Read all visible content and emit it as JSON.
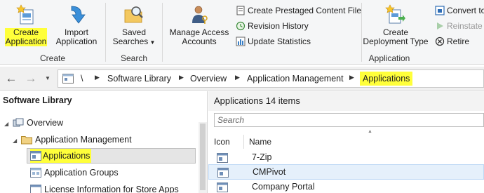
{
  "ribbon": {
    "create_application": "Create\nApplication",
    "create_line1": "Create",
    "create_line2": "Application",
    "import_line1": "Import",
    "import_line2": "Application",
    "group_create": "Create",
    "saved_line1": "Saved",
    "saved_line2": "Searches",
    "group_search": "Search",
    "manage_line1": "Manage Access",
    "manage_line2": "Accounts",
    "create_prestaged": "Create Prestaged Content File",
    "revision_history": "Revision History",
    "update_statistics": "Update Statistics",
    "deploy_line1": "Create",
    "deploy_line2": "Deployment Type",
    "group_application": "Application",
    "convert_to": "Convert to",
    "reinstate": "Reinstate",
    "retire": "Retire"
  },
  "breadcrumb": {
    "root": "\\",
    "items": [
      "Software Library",
      "Overview",
      "Application Management",
      "Applications"
    ]
  },
  "left_pane": {
    "title": "Software Library",
    "tree": {
      "overview": "Overview",
      "app_mgmt": "Application Management",
      "applications": "Applications",
      "app_groups": "Application Groups",
      "license_info": "License Information for Store Apps"
    }
  },
  "right_pane": {
    "header_title": "Applications",
    "header_count": "14 items",
    "search_placeholder": "Search",
    "col_icon": "Icon",
    "col_name": "Name",
    "rows": [
      "7-Zip",
      "CMPivot",
      "Company Portal"
    ]
  },
  "colors": {
    "highlight": "#ffff3a",
    "selection": "#e5f0fb"
  }
}
